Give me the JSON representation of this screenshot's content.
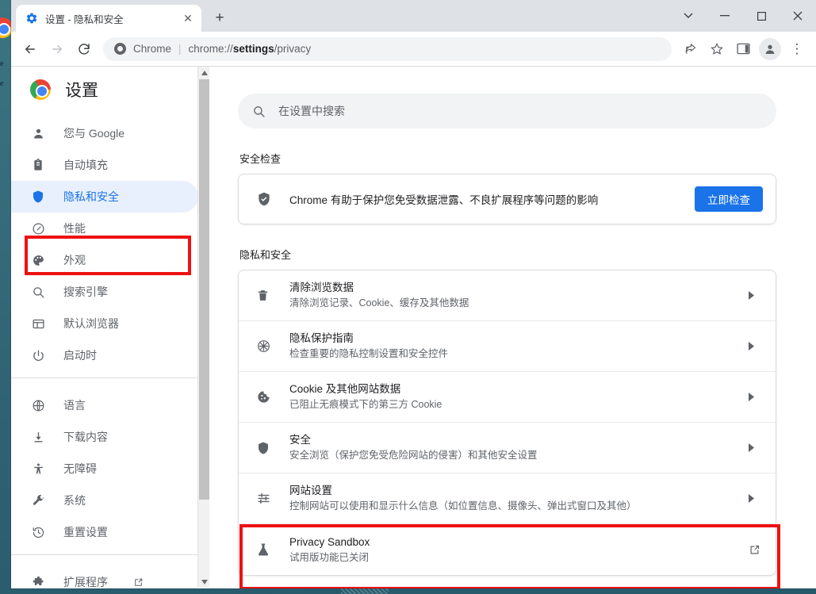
{
  "window": {
    "controls": {
      "tab_search": "tab-search-icon",
      "minimize": "minimize-icon",
      "maximize": "maximize-icon",
      "close": "close-icon"
    }
  },
  "tabs": [
    {
      "title": "设置 - 隐私和安全",
      "favicon": "gear-icon",
      "close_label": "✕"
    }
  ],
  "new_tab_label": "+",
  "toolbar": {
    "back_label": "←",
    "forward_label": "→",
    "reload_label": "⟳",
    "omnibox": {
      "site_label": "Chrome",
      "separator": "|",
      "url_prefix": "chrome://",
      "url_bold": "settings",
      "url_suffix": "/privacy"
    },
    "share_label": "share-icon",
    "bookmark_label": "star-icon",
    "sidepanel_label": "side-panel-icon",
    "profile_label": "profile-avatar",
    "menu_label": "⋮"
  },
  "settings": {
    "title": "设置",
    "logo": "chrome-logo"
  },
  "search": {
    "placeholder": "在设置中搜索",
    "icon": "search-icon"
  },
  "sidebar": {
    "groups": [
      {
        "items": [
          {
            "label": "您与 Google",
            "icon": "person-icon",
            "active": false
          },
          {
            "label": "自动填充",
            "icon": "clipboard-icon",
            "active": false
          },
          {
            "label": "隐私和安全",
            "icon": "shield-icon",
            "active": true
          },
          {
            "label": "性能",
            "icon": "speedometer-icon",
            "active": false
          },
          {
            "label": "外观",
            "icon": "palette-icon",
            "active": false
          },
          {
            "label": "搜索引擎",
            "icon": "search-icon",
            "active": false
          },
          {
            "label": "默认浏览器",
            "icon": "browser-window-icon",
            "active": false
          },
          {
            "label": "启动时",
            "icon": "power-icon",
            "active": false
          }
        ]
      },
      {
        "items": [
          {
            "label": "语言",
            "icon": "globe-icon",
            "active": false
          },
          {
            "label": "下载内容",
            "icon": "download-icon",
            "active": false
          },
          {
            "label": "无障碍",
            "icon": "accessibility-icon",
            "active": false
          },
          {
            "label": "系统",
            "icon": "wrench-icon",
            "active": false
          },
          {
            "label": "重置设置",
            "icon": "history-restore-icon",
            "active": false
          }
        ]
      },
      {
        "items": [
          {
            "label": "扩展程序",
            "icon": "puzzle-icon",
            "active": false,
            "external": true
          }
        ]
      }
    ]
  },
  "main": {
    "safety_check": {
      "heading": "安全检查",
      "icon": "shield-check-icon",
      "description": "Chrome 有助于保护您免受数据泄露、不良扩展程序等问题的影响",
      "button_label": "立即检查"
    },
    "privacy": {
      "heading": "隐私和安全",
      "rows": [
        {
          "icon": "trash-icon",
          "title": "清除浏览数据",
          "subtitle": "清除浏览记录、Cookie、缓存及其他数据",
          "action": "arrow"
        },
        {
          "icon": "privacy-guide-icon",
          "title": "隐私保护指南",
          "subtitle": "检查重要的隐私控制设置和安全控件",
          "action": "arrow"
        },
        {
          "icon": "cookie-icon",
          "title": "Cookie 及其他网站数据",
          "subtitle": "已阻止无痕模式下的第三方 Cookie",
          "action": "arrow"
        },
        {
          "icon": "shield-icon",
          "title": "安全",
          "subtitle": "安全浏览（保护您免受危险网站的侵害）和其他安全设置",
          "action": "arrow"
        },
        {
          "icon": "sliders-icon",
          "title": "网站设置",
          "subtitle": "控制网站可以使用和显示什么信息（如位置信息、摄像头、弹出式窗口及其他）",
          "action": "arrow"
        },
        {
          "icon": "flask-icon",
          "title": "Privacy Sandbox",
          "subtitle": "试用版功能已关闭",
          "action": "external"
        }
      ]
    }
  },
  "annotations": {
    "color": "#ee1111",
    "boxes": [
      {
        "name": "highlight-sidebar-privacy",
        "target": "隐私和安全"
      },
      {
        "name": "highlight-site-settings",
        "target": "网站设置"
      }
    ]
  },
  "colors": {
    "accent": "#1a73e8",
    "active_nav_bg": "#e8f0fe",
    "tabstrip_bg": "#dee1e6",
    "desktop_bg": "#37717f",
    "highlight": "#ee1111"
  }
}
